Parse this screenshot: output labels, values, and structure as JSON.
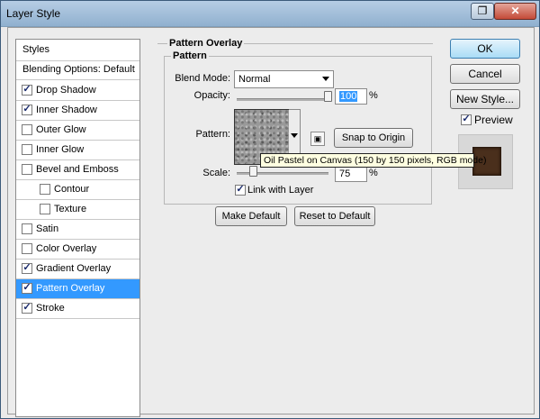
{
  "window": {
    "title": "Layer Style"
  },
  "styles_panel": {
    "header": "Styles",
    "items": [
      {
        "label": "Blending Options: Default",
        "checkbox": false,
        "checked": false,
        "indent": 0,
        "selected": false
      },
      {
        "label": "Drop Shadow",
        "checkbox": true,
        "checked": true,
        "indent": 0,
        "selected": false
      },
      {
        "label": "Inner Shadow",
        "checkbox": true,
        "checked": true,
        "indent": 0,
        "selected": false
      },
      {
        "label": "Outer Glow",
        "checkbox": true,
        "checked": false,
        "indent": 0,
        "selected": false
      },
      {
        "label": "Inner Glow",
        "checkbox": true,
        "checked": false,
        "indent": 0,
        "selected": false
      },
      {
        "label": "Bevel and Emboss",
        "checkbox": true,
        "checked": false,
        "indent": 0,
        "selected": false
      },
      {
        "label": "Contour",
        "checkbox": true,
        "checked": false,
        "indent": 1,
        "selected": false
      },
      {
        "label": "Texture",
        "checkbox": true,
        "checked": false,
        "indent": 1,
        "selected": false
      },
      {
        "label": "Satin",
        "checkbox": true,
        "checked": false,
        "indent": 0,
        "selected": false
      },
      {
        "label": "Color Overlay",
        "checkbox": true,
        "checked": false,
        "indent": 0,
        "selected": false
      },
      {
        "label": "Gradient Overlay",
        "checkbox": true,
        "checked": true,
        "indent": 0,
        "selected": false
      },
      {
        "label": "Pattern Overlay",
        "checkbox": true,
        "checked": true,
        "indent": 0,
        "selected": true
      },
      {
        "label": "Stroke",
        "checkbox": true,
        "checked": true,
        "indent": 0,
        "selected": false
      }
    ]
  },
  "pattern_overlay": {
    "group_title": "Pattern Overlay",
    "inner_group_title": "Pattern",
    "blend_mode_label": "Blend Mode:",
    "blend_mode_value": "Normal",
    "opacity_label": "Opacity:",
    "opacity_value": "100",
    "opacity_unit": "%",
    "opacity_level": 1.0,
    "pattern_label": "Pattern:",
    "snap_button": "Snap to Origin",
    "scale_label": "Scale:",
    "scale_value": "75",
    "scale_unit": "%",
    "scale_level": 0.75,
    "link_label": "Link with Layer",
    "link_checked": true,
    "make_default_button": "Make Default",
    "reset_default_button": "Reset to Default",
    "tooltip": "Oil Pastel on Canvas (150 by 150 pixels, RGB mode)"
  },
  "buttons": {
    "ok": "OK",
    "cancel": "Cancel",
    "new_style": "New Style...",
    "preview_label": "Preview",
    "preview_checked": true
  },
  "preview": {
    "color": "#4a2f1c"
  },
  "icons": {
    "restore": "restore-icon",
    "close": "close-icon",
    "new_preset": "new-preset-icon",
    "check": "check-icon"
  }
}
